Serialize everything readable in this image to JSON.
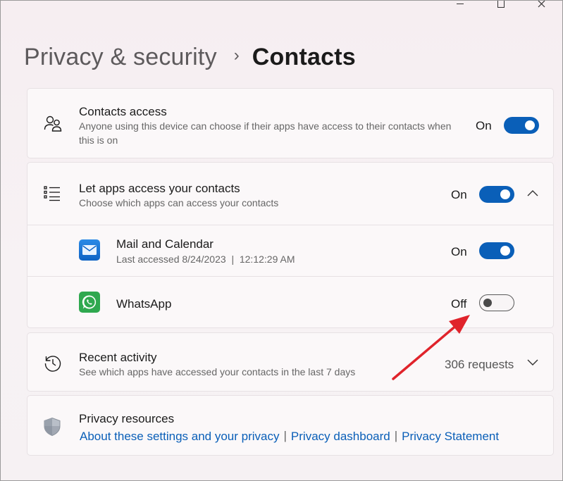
{
  "window": {
    "caption": {
      "minimize": "minimize-icon",
      "maximize": "maximize-icon",
      "close": "close-icon"
    }
  },
  "header": {
    "parent": "Privacy & security",
    "separator": "›",
    "current": "Contacts"
  },
  "contacts_access": {
    "icon": "people-icon",
    "title": "Contacts access",
    "description": "Anyone using this device can choose if their apps have access to their contacts when this is on",
    "state": "On",
    "toggle_on": true
  },
  "apps_access": {
    "icon": "list-icon",
    "title": "Let apps access your contacts",
    "description": "Choose which apps can access your contacts",
    "state": "On",
    "toggle_on": true,
    "expanded": true,
    "apps": [
      {
        "name": "Mail and Calendar",
        "last_accessed": "Last accessed 8/24/2023  |  12:12:29 AM",
        "state": "On",
        "toggle_on": true,
        "icon": "mail-icon"
      },
      {
        "name": "WhatsApp",
        "state": "Off",
        "toggle_on": false,
        "icon": "whatsapp-icon"
      }
    ]
  },
  "recent_activity": {
    "icon": "history-icon",
    "title": "Recent activity",
    "description": "See which apps have accessed your contacts in the last 7 days",
    "count": "306 requests"
  },
  "privacy_resources": {
    "icon": "shield-icon",
    "title": "Privacy resources",
    "links": [
      "About these settings and your privacy",
      "Privacy dashboard",
      "Privacy Statement"
    ],
    "separator": "|"
  },
  "colors": {
    "accent": "#0a5fb8",
    "annotation_arrow": "#e0232b"
  }
}
